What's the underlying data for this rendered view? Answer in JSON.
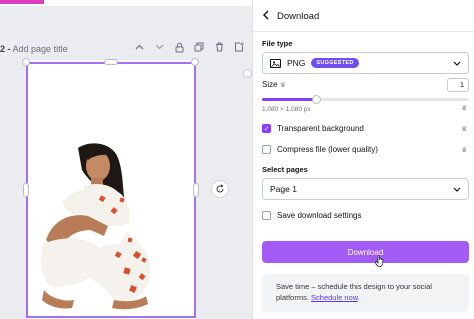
{
  "editor": {
    "page_number": "2 -",
    "page_title_placeholder": "Add page title"
  },
  "panel": {
    "title": "Download",
    "file_type_label": "File type",
    "file_type_value": "PNG",
    "suggested_badge": "SUGGESTED",
    "size_label": "Size",
    "size_value": "1",
    "size_slider_fraction": 0.26,
    "dimensions": "1,080 × 1,080 px",
    "transparent_bg_label": "Transparent background",
    "transparent_bg_checked": true,
    "compress_label": "Compress file (lower quality)",
    "compress_checked": false,
    "select_pages_label": "Select pages",
    "select_pages_value": "Page 1",
    "save_settings_label": "Save download settings",
    "save_settings_checked": false,
    "download_button": "Download",
    "info_text": "Save time – schedule this design to your social platforms.",
    "info_link": "Schedule now",
    "info_period": "."
  },
  "colors": {
    "accent": "#8b3dff",
    "button": "#a25cf5",
    "badge": "#6f4ef2"
  },
  "icons": [
    "back-arrow-icon",
    "image-file-icon",
    "chevron-down-icon",
    "crown-icon",
    "rotate-icon",
    "lock-icon",
    "duplicate-icon",
    "trash-icon",
    "add-page-icon",
    "chevron-up-icon"
  ]
}
